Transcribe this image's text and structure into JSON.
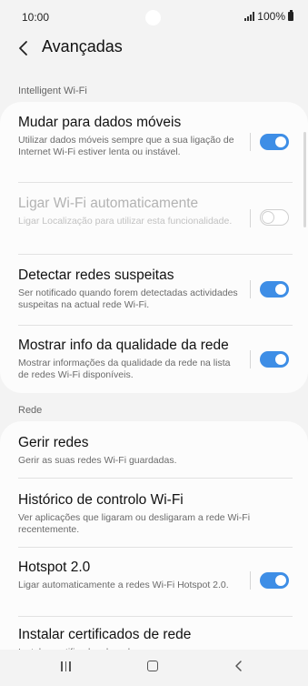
{
  "status": {
    "time": "10:00",
    "battery": "100%"
  },
  "header": {
    "title": "Avançadas"
  },
  "sections": {
    "intelligent": {
      "label": "Intelligent Wi-Fi",
      "items": [
        {
          "title": "Mudar para dados móveis",
          "description": "Utilizar dados móveis sempre que a sua ligação de Internet Wi-Fi estiver lenta ou instável.",
          "toggle": true,
          "enabled": true
        },
        {
          "title": "Ligar Wi-Fi automaticamente",
          "description": "Ligar Localização para utilizar esta funcionalidade.",
          "toggle": false,
          "enabled": false
        },
        {
          "title": "Detectar redes suspeitas",
          "description": "Ser notificado quando forem detectadas actividades suspeitas na actual rede Wi-Fi.",
          "toggle": true,
          "enabled": true
        },
        {
          "title": "Mostrar info da qualidade da rede",
          "description": "Mostrar informações da qualidade da rede na lista de redes Wi-Fi disponíveis.",
          "toggle": true,
          "enabled": true
        }
      ]
    },
    "rede": {
      "label": "Rede",
      "items": [
        {
          "title": "Gerir redes",
          "description": "Gerir as suas redes Wi-Fi guardadas."
        },
        {
          "title": "Histórico de controlo Wi-Fi",
          "description": "Ver aplicações que ligaram ou desligaram a rede Wi-Fi recentemente."
        },
        {
          "title": "Hotspot 2.0",
          "description": "Ligar automaticamente a redes Wi-Fi Hotspot 2.0.",
          "toggle": true
        },
        {
          "title": "Instalar certificados de rede",
          "description": "Instalar certificados de rede"
        }
      ]
    }
  },
  "icons": {
    "back": "chevron-left-icon",
    "signal": "signal-icon",
    "battery": "battery-icon",
    "nav_recent": "recent-apps-icon",
    "nav_home": "home-icon",
    "nav_back": "nav-back-icon"
  },
  "colors": {
    "accent": "#3e8ee6",
    "background": "#f3f3f3",
    "card": "#fcfcfc"
  }
}
